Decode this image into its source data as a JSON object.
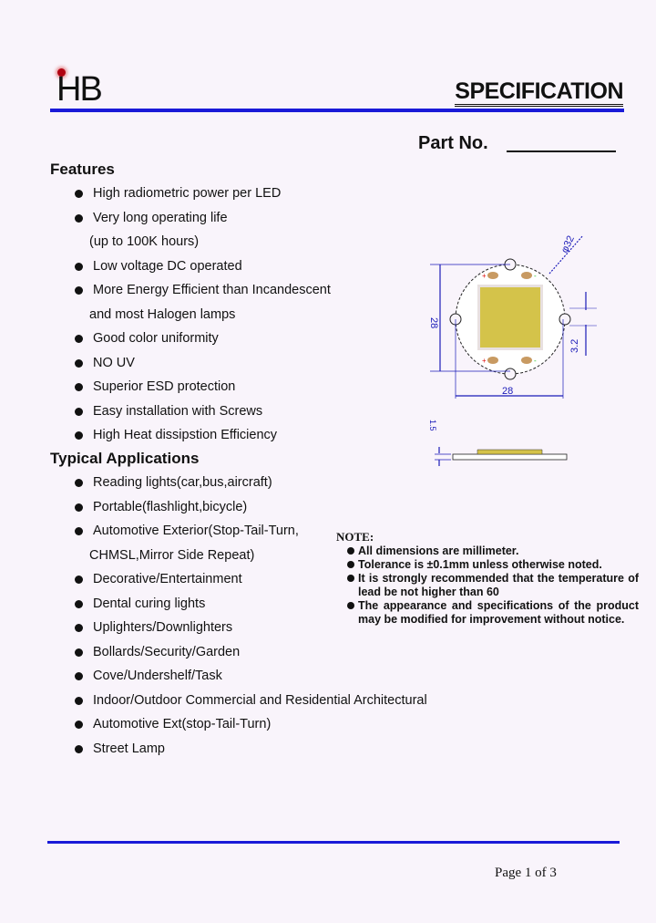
{
  "header": {
    "logo_text": "HB",
    "title": "SPECIFICATION",
    "part_no_label": "Part No."
  },
  "features": {
    "heading": "Features",
    "items": [
      {
        "text": "High radiometric power per LED",
        "bullet": true
      },
      {
        "text": "Very long operating life",
        "bullet": true
      },
      {
        "text": "(up to 100K hours)",
        "bullet": false
      },
      {
        "text": "Low voltage DC operated",
        "bullet": true
      },
      {
        "text": "More Energy Efficient than Incandescent",
        "bullet": true
      },
      {
        "text": "and most Halogen lamps",
        "bullet": false
      },
      {
        "text": "Good color uniformity",
        "bullet": true
      },
      {
        "text": "NO UV",
        "bullet": true
      },
      {
        "text": "Superior ESD protection",
        "bullet": true
      },
      {
        "text": "Easy installation with Screws",
        "bullet": true
      },
      {
        "text": "High Heat dissipstion Efficiency",
        "bullet": true
      }
    ]
  },
  "applications": {
    "heading": "Typical Applications",
    "items": [
      {
        "text": "Reading lights(car,bus,aircraft)",
        "bullet": true
      },
      {
        "text": "Portable(flashlight,bicycle)",
        "bullet": true
      },
      {
        "text": "Automotive Exterior(Stop-Tail-Turn,",
        "bullet": true
      },
      {
        "text": "CHMSL,Mirror Side Repeat)",
        "bullet": false
      },
      {
        "text": "Decorative/Entertainment",
        "bullet": true
      },
      {
        "text": "Dental curing lights",
        "bullet": true
      },
      {
        "text": "Uplighters/Downlighters",
        "bullet": true
      },
      {
        "text": "Bollards/Security/Garden",
        "bullet": true
      },
      {
        "text": "Cove/Undershelf/Task",
        "bullet": true
      },
      {
        "text": "Indoor/Outdoor Commercial and Residential Architectural",
        "bullet": true
      },
      {
        "text": "Automotive Ext(stop-Tail-Turn)",
        "bullet": true
      },
      {
        "text": "Street Lamp",
        "bullet": true
      }
    ]
  },
  "drawing": {
    "dim_diameter": "φ32",
    "dim_height": "28",
    "dim_width": "28",
    "dim_slot": "3.2",
    "dim_thickness": "1.5",
    "plus": "+",
    "minus": "-",
    "colors": {
      "dimension": "#1a1ab8",
      "chip": "#d4c34a",
      "pad": "#c89a62",
      "plus": "#e01010",
      "minus": "#20c020"
    }
  },
  "note": {
    "title": "NOTE:",
    "items": [
      "All dimensions are millimeter.",
      "Tolerance is ±0.1mm unless otherwise noted.",
      "It is strongly recommended that the temperature of lead be not higher than 60",
      "The appearance and specifications of the product may be modified for improvement without notice."
    ]
  },
  "footer": {
    "page": "Page 1 of 3"
  },
  "colors": {
    "rule": "#1a1ad8",
    "background": "#f9f4fb"
  }
}
